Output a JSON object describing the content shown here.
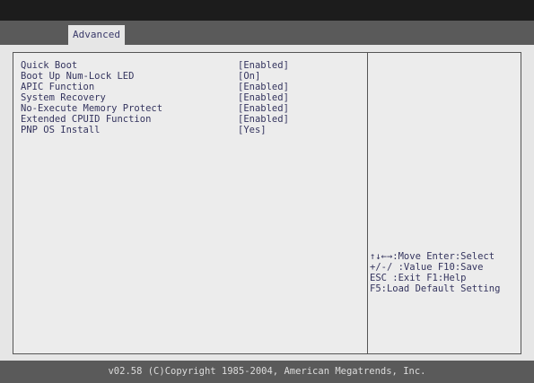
{
  "tabs": [
    {
      "label": "Advanced"
    }
  ],
  "settings": [
    {
      "name": "Quick Boot",
      "value": "[Enabled]"
    },
    {
      "name": "Boot Up Num-Lock LED",
      "value": "[On]"
    },
    {
      "name": "APIC Function",
      "value": "[Enabled]"
    },
    {
      "name": "System Recovery",
      "value": "[Enabled]"
    },
    {
      "name": "No-Execute Memory Protect",
      "value": "[Enabled]"
    },
    {
      "name": "Extended CPUID Function",
      "value": "[Enabled]"
    },
    {
      "name": "PNP OS Install",
      "value": "[Yes]"
    }
  ],
  "help": [
    "↑↓←→:Move Enter:Select",
    "+/-/ :Value  F10:Save",
    "ESC  :Exit  F1:Help",
    "F5:Load Default Setting"
  ],
  "footer": "v02.58 (C)Copyright 1985-2004, American Megatrends, Inc.",
  "colors": {
    "background": "#e6e6e6",
    "text": "#34345e",
    "bar": "#5a5a5a",
    "top": "#1c1c1c"
  }
}
